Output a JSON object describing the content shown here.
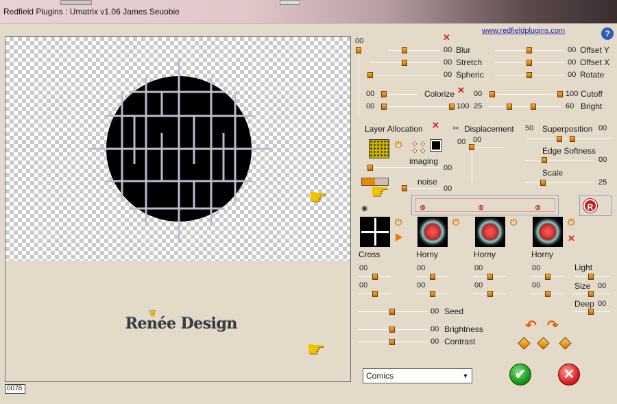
{
  "window": {
    "title": "Redfield Plugins : Umatrix v1.06   James Seuobie"
  },
  "header": {
    "link_text": "www.redfieldplugins.com",
    "help_label": "?"
  },
  "preview": {
    "counter": "0078",
    "watermark": "Renée Design"
  },
  "sliders": {
    "top_value": "00",
    "blur": {
      "label": "Blur",
      "value": "00"
    },
    "offset_y": {
      "label": "Offset Y",
      "value": "00"
    },
    "stretch": {
      "label": "Stretch",
      "value": "00"
    },
    "offset_x": {
      "label": "Offset X",
      "value": "00"
    },
    "spheric": {
      "label": "Spheric",
      "value": "00"
    },
    "rotate": {
      "label": "Rotate",
      "value": "00"
    },
    "colorize": {
      "label": "Colorize",
      "left_value": "00",
      "right_value": "00"
    },
    "cutoff": {
      "label": "Cutoff",
      "value": "100"
    },
    "bright_row": {
      "left_value": "00",
      "mid_value": "100",
      "right_value": "25",
      "bright_value": "60",
      "label": "Bright"
    }
  },
  "layer": {
    "allocation_label": "Layer Allocation",
    "displacement_label": "Displacement",
    "displacement_value_1": "00",
    "displacement_value_2": "00",
    "imaging_label": "imaging",
    "imaging_value": "00",
    "noise_label": "noise",
    "noise_value": "00",
    "superposition_label": "Superposition",
    "superposition_left": "50",
    "superposition_right": "00",
    "edge_label": "Edge Softness",
    "edge_value": "00",
    "scale_label": "Scale",
    "scale_value": "25"
  },
  "patterns": [
    {
      "name": "Cross",
      "v1": "00",
      "v2": "00"
    },
    {
      "name": "Horny",
      "v1": "00",
      "v2": "00"
    },
    {
      "name": "Horny",
      "v1": "00",
      "v2": "00"
    },
    {
      "name": "Horny",
      "v1": "00",
      "v2": "00"
    }
  ],
  "lighting": {
    "light_label": "Light",
    "size_label": "Size",
    "size_value": "00",
    "deep_label": "Deep",
    "deep_value": "00"
  },
  "bottom": {
    "seed": {
      "label": "Seed",
      "value": "00"
    },
    "brightness": {
      "label": "Brightness",
      "value": "00"
    },
    "contrast": {
      "label": "Contrast",
      "value": "00"
    }
  },
  "preset": {
    "selected": "Comics"
  },
  "reset_label": "R",
  "colors": {
    "accent": "#e88a00",
    "knob": "#d87800",
    "panel": "#e4dac9"
  }
}
